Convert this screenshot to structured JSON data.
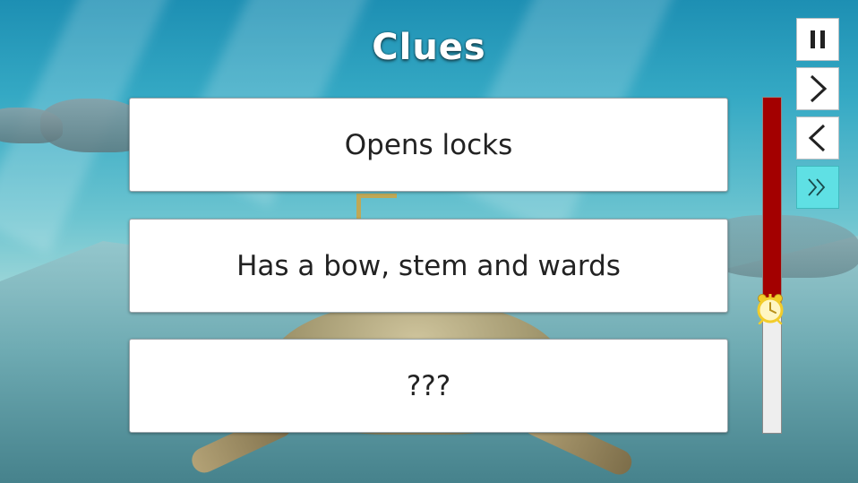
{
  "game": {
    "title": "Clues",
    "clues": [
      "Opens locks",
      "Has a bow, stem and wards",
      "???"
    ],
    "timer": {
      "remaining_fraction": 0.63,
      "fill_color": "#a30000",
      "icon": "alarm-clock-icon"
    },
    "controls": [
      {
        "name": "pause-button",
        "icon": "pause-icon"
      },
      {
        "name": "next-button",
        "icon": "chevron-right-icon"
      },
      {
        "name": "previous-button",
        "icon": "chevron-left-icon"
      },
      {
        "name": "skip-button",
        "icon": "double-chevron-right-icon",
        "color": "#5fe0e4"
      }
    ]
  }
}
